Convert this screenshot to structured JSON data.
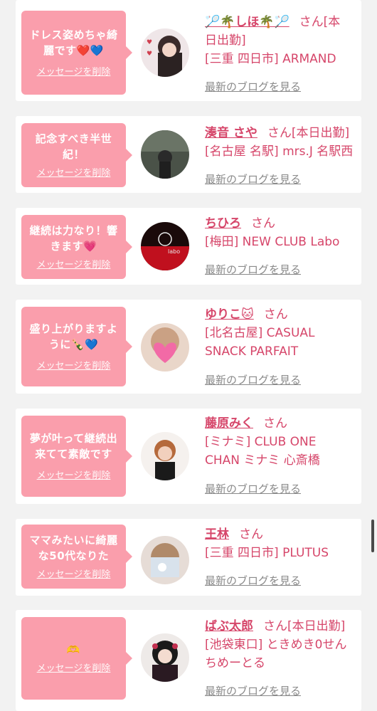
{
  "delete_label": "メッセージを削除",
  "blog_label": "最新のブログを見る",
  "san": "さん",
  "colors": {
    "bubble": "#fa9eac",
    "accent": "#d6466a",
    "muted": "#8a8a8a",
    "background": "#f2f2f2"
  },
  "cards": [
    {
      "message_lines": [
        "ドレス姿めちゃ綺",
        "麗です❤️💙"
      ],
      "name": "🏸🌴しほ🌴🏸",
      "san_suffix": "さん[本",
      "extra_lines": [
        "日出勤]",
        "[三重 四日市] ARMAND"
      ]
    },
    {
      "message_lines": [
        "記念すべき半世",
        "紀！"
      ],
      "name": "湊音 さや",
      "san_suffix": "さん[本日出勤]",
      "extra_lines": [
        "[名古屋 名駅] mrs.J 名駅西"
      ]
    },
    {
      "message_lines": [
        "継続は力なり！響",
        "きます💗"
      ],
      "name": "ちひろ",
      "san_suffix": "さん",
      "extra_lines": [
        "[梅田] NEW CLUB Labo"
      ]
    },
    {
      "message_lines": [
        "盛り上がりますよ",
        "うに🍾💙"
      ],
      "name": "ゆりこ🐱",
      "san_suffix": "さん",
      "extra_lines": [
        "[北名古屋] CASUAL",
        "SNACK PARFAIT"
      ]
    },
    {
      "message_lines": [
        "夢が叶って継続出",
        "来てて素敵です"
      ],
      "name": "藤原みく",
      "san_suffix": "さん",
      "extra_lines": [
        "[ミナミ] CLUB ONE",
        "CHAN ミナミ 心斎橋"
      ]
    },
    {
      "message_lines": [
        "ママみたいに綺麗",
        "な50代なりた"
      ],
      "name": "王林",
      "san_suffix": "さん",
      "extra_lines": [
        "[三重 四日市] PLUTUS"
      ]
    },
    {
      "message_lines": [
        "🫶"
      ],
      "name": "ばぶ太郎",
      "san_suffix": "さん[本日出勤]",
      "extra_lines": [
        "[池袋東口] ときめき0せん",
        "ちめーとる"
      ]
    }
  ]
}
